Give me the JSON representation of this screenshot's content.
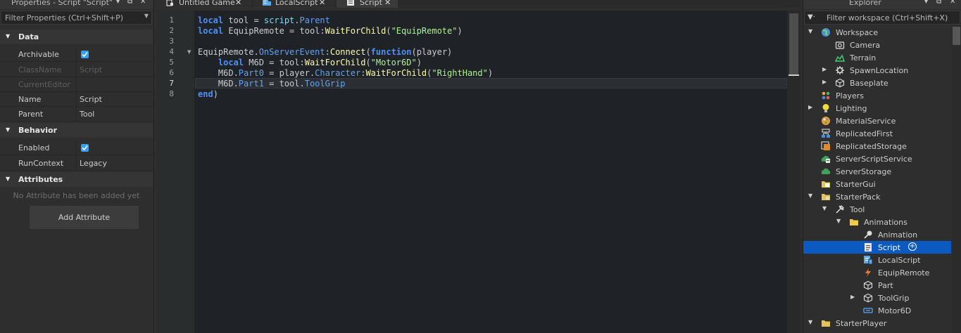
{
  "properties": {
    "title": "Properties - Script \"Script\"",
    "filter_placeholder": "Filter Properties (Ctrl+Shift+P)",
    "sections": {
      "data": "Data",
      "behavior": "Behavior",
      "attributes": "Attributes"
    },
    "rows": {
      "archivable": {
        "label": "Archivable",
        "checked": true
      },
      "classname": {
        "label": "ClassName",
        "value": "Script"
      },
      "currenteditor": {
        "label": "CurrentEditor",
        "value": ""
      },
      "name": {
        "label": "Name",
        "value": "Script"
      },
      "parent": {
        "label": "Parent",
        "value": "Tool"
      },
      "enabled": {
        "label": "Enabled",
        "checked": true
      },
      "runcontext": {
        "label": "RunContext",
        "value": "Legacy"
      }
    },
    "no_attributes": "No Attribute has been added yet",
    "add_attribute": "Add Attribute"
  },
  "tabs": [
    {
      "label": "Untitled Game",
      "icon": "game-icon",
      "active": false
    },
    {
      "label": "LocalScript",
      "icon": "localscript-icon",
      "active": false
    },
    {
      "label": "Script",
      "icon": "script-icon",
      "active": true
    }
  ],
  "editor": {
    "current_line": 7,
    "line_numbers": [
      "1",
      "2",
      "3",
      "4",
      "5",
      "6",
      "7",
      "8"
    ],
    "code_lines": [
      "local tool = script.Parent",
      "local EquipRemote = tool:WaitForChild(\"EquipRemote\")",
      "",
      "EquipRemote.OnServerEvent:Connect(function(player)",
      "    local M6D = tool:WaitForChild(\"Motor6D\")",
      "    M6D.Part0 = player.Character:WaitForChild(\"RightHand\")",
      "    M6D.Part1 = tool.ToolGrip",
      "end)"
    ]
  },
  "explorer": {
    "title": "Explorer",
    "filter_placeholder": "Filter workspace (Ctrl+Shift+X)",
    "items": [
      {
        "label": "Workspace",
        "icon": "workspace-icon",
        "expanded": true
      },
      {
        "label": "Camera",
        "icon": "camera-icon"
      },
      {
        "label": "Terrain",
        "icon": "terrain-icon"
      },
      {
        "label": "SpawnLocation",
        "icon": "spawnlocation-icon",
        "expanded": false
      },
      {
        "label": "Baseplate",
        "icon": "part-icon",
        "expanded": false
      },
      {
        "label": "Players",
        "icon": "players-icon"
      },
      {
        "label": "Lighting",
        "icon": "lighting-icon",
        "expanded": false
      },
      {
        "label": "MaterialService",
        "icon": "materialservice-icon"
      },
      {
        "label": "ReplicatedFirst",
        "icon": "replicatedfirst-icon"
      },
      {
        "label": "ReplicatedStorage",
        "icon": "replicatedstorage-icon"
      },
      {
        "label": "ServerScriptService",
        "icon": "serverscriptservice-icon"
      },
      {
        "label": "ServerStorage",
        "icon": "serverstorage-icon"
      },
      {
        "label": "StarterGui",
        "icon": "startergui-icon"
      },
      {
        "label": "StarterPack",
        "icon": "starterpack-icon",
        "expanded": true
      },
      {
        "label": "Tool",
        "icon": "tool-icon",
        "expanded": true
      },
      {
        "label": "Animations",
        "icon": "folder-icon",
        "expanded": true
      },
      {
        "label": "Animation",
        "icon": "animation-icon"
      },
      {
        "label": "Script",
        "icon": "script-icon",
        "selected": true
      },
      {
        "label": "LocalScript",
        "icon": "localscript-icon"
      },
      {
        "label": "EquipRemote",
        "icon": "remoteevent-icon"
      },
      {
        "label": "Part",
        "icon": "part-icon"
      },
      {
        "label": "ToolGrip",
        "icon": "part-icon",
        "expanded": false
      },
      {
        "label": "Motor6D",
        "icon": "motor6d-icon"
      },
      {
        "label": "StarterPlayer",
        "icon": "starterplayer-icon",
        "expanded": true
      }
    ]
  },
  "colors": {
    "accent": "#35a0ff",
    "selection": "#0b5ac1",
    "keyword": "#4f8ff7",
    "string": "#adf195",
    "method": "#fdfbac",
    "builtin": "#84d6f7"
  }
}
